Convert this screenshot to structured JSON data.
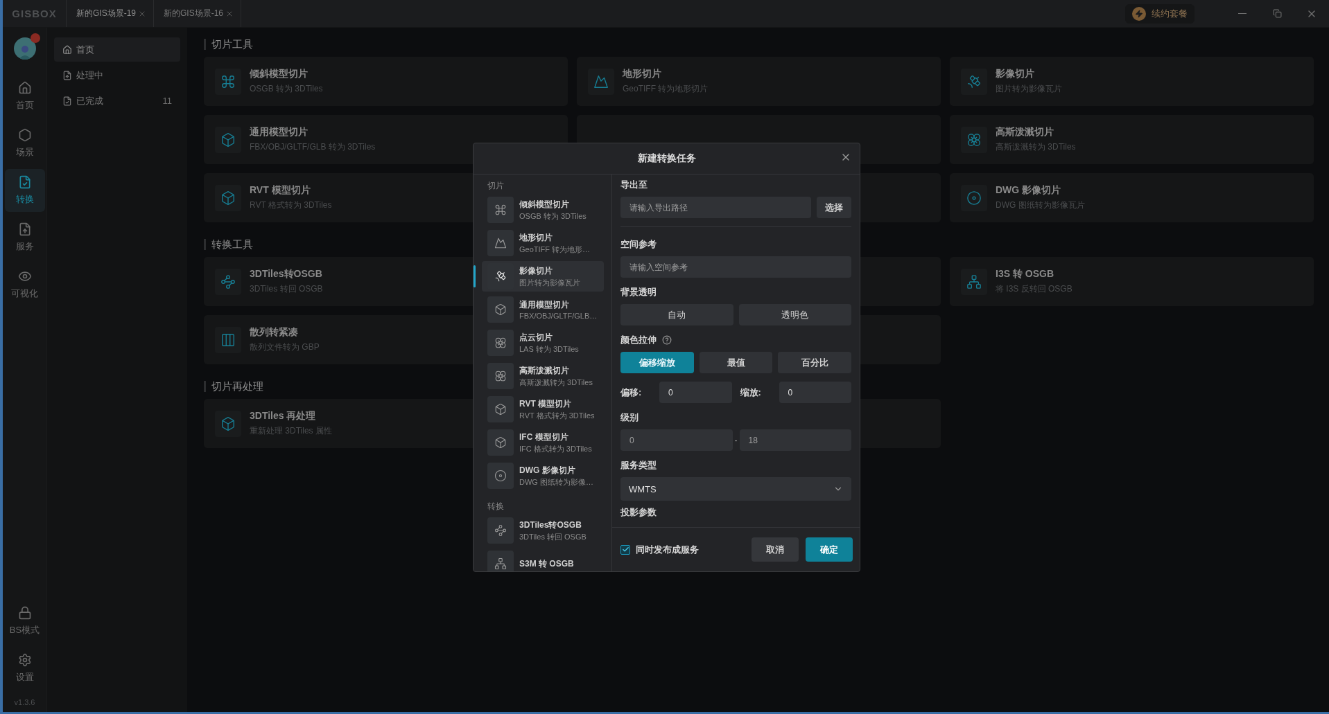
{
  "titlebar": {
    "logo": "GISBOX",
    "tabs": [
      {
        "label": "新的GIS场景-19",
        "selected": true
      },
      {
        "label": "新的GIS场景-16",
        "selected": false
      }
    ],
    "renew_button": "续约套餐"
  },
  "rail": {
    "items": [
      {
        "label": "首页",
        "selected": false
      },
      {
        "label": "场景",
        "selected": false
      },
      {
        "label": "转换",
        "selected": true
      },
      {
        "label": "服务",
        "selected": false
      },
      {
        "label": "可视化",
        "selected": false
      }
    ],
    "bottom_items": [
      {
        "label": "BS模式"
      },
      {
        "label": "设置"
      }
    ],
    "version": "v1.3.6"
  },
  "nav": {
    "items": [
      {
        "label": "首页",
        "selected": true
      },
      {
        "label": "处理中",
        "selected": false
      },
      {
        "label": "已完成",
        "selected": false,
        "count": "11"
      }
    ]
  },
  "sections": [
    {
      "title": "切片工具",
      "cards": [
        {
          "kind": "tool",
          "title": "倾斜模型切片",
          "subtitle": "OSGB 转为 3DTiles"
        },
        {
          "kind": "tool",
          "title": "地形切片",
          "subtitle": "GeoTIFF 转为地形切片"
        },
        {
          "kind": "tool",
          "title": "影像切片",
          "subtitle": "图片转为影像瓦片"
        },
        {
          "kind": "tool",
          "title": "通用模型切片",
          "subtitle": "FBX/OBJ/GLTF/GLB 转为 3DTiles"
        },
        {
          "kind": "covered"
        },
        {
          "kind": "tool",
          "title": "高斯泼溅切片",
          "subtitle": "高斯泼溅转为 3DTiles"
        },
        {
          "kind": "tool",
          "title": "RVT 模型切片",
          "subtitle": "RVT 格式转为 3DTiles"
        },
        {
          "kind": "covered"
        },
        {
          "kind": "tool",
          "title": "DWG 影像切片",
          "subtitle": "DWG 图纸转为影像瓦片"
        }
      ]
    },
    {
      "title": "转换工具",
      "cards": [
        {
          "kind": "tool",
          "title": "3DTiles转OSGB",
          "subtitle": "3DTiles 转回 OSGB"
        },
        {
          "kind": "covered"
        },
        {
          "kind": "tool",
          "title": "I3S 转 OSGB",
          "subtitle": "将 I3S 反转回 OSGB"
        },
        {
          "kind": "tool",
          "title": "散列转紧凑",
          "subtitle": "散列文件转为 GBP"
        },
        {
          "kind": "covered"
        }
      ]
    },
    {
      "title": "切片再处理",
      "cards": [
        {
          "kind": "tool",
          "title": "3DTiles 再处理",
          "subtitle": "重新处理 3DTiles 属性"
        },
        {
          "kind": "covered"
        }
      ]
    }
  ],
  "dialog": {
    "title": "新建转换任务",
    "groups": [
      {
        "title": "切片",
        "items": [
          {
            "title": "倾斜模型切片",
            "subtitle": "OSGB 转为 3DTiles",
            "selected": false
          },
          {
            "title": "地形切片",
            "subtitle": "GeoTIFF 转为地形…",
            "selected": false
          },
          {
            "title": "影像切片",
            "subtitle": "图片转为影像瓦片",
            "selected": true
          },
          {
            "title": "通用模型切片",
            "subtitle": "FBX/OBJ/GLTF/GLB…",
            "selected": false
          },
          {
            "title": "点云切片",
            "subtitle": "LAS 转为 3DTiles",
            "selected": false
          },
          {
            "title": "高斯泼溅切片",
            "subtitle": "高斯泼溅转为 3DTiles",
            "selected": false
          },
          {
            "title": "RVT 模型切片",
            "subtitle": "RVT 格式转为 3DTiles",
            "selected": false
          },
          {
            "title": "IFC 模型切片",
            "subtitle": "IFC 格式转为 3DTiles",
            "selected": false
          },
          {
            "title": "DWG 影像切片",
            "subtitle": "DWG 图纸转为影像…",
            "selected": false
          }
        ]
      },
      {
        "title": "转换",
        "items": [
          {
            "title": "3DTiles转OSGB",
            "subtitle": "3DTiles 转回 OSGB",
            "selected": false
          },
          {
            "title": "S3M 转 OSGB",
            "selected": false
          }
        ]
      }
    ],
    "export": {
      "label": "导出至",
      "placeholder": "请输入导出路径",
      "button": "选择"
    },
    "spatial_ref": {
      "label": "空间参考",
      "placeholder": "请输入空间参考"
    },
    "background": {
      "label": "背景透明",
      "options": [
        {
          "label": "自动",
          "selected": false
        },
        {
          "label": "透明色",
          "selected": false
        }
      ]
    },
    "stretch": {
      "label": "颜色拉伸",
      "options": [
        {
          "label": "偏移缩放",
          "selected": true
        },
        {
          "label": "最值",
          "selected": false
        },
        {
          "label": "百分比",
          "selected": false
        }
      ]
    },
    "offset": {
      "label": "偏移:",
      "value": "0"
    },
    "scale": {
      "label": "缩放:",
      "value": "0"
    },
    "level": {
      "label": "级别",
      "from_placeholder": "0",
      "separator": "-",
      "to_placeholder": "18"
    },
    "service_type": {
      "label": "服务类型",
      "value": "WMTS"
    },
    "projection": {
      "label": "投影参数"
    },
    "publish": {
      "label": "同时发布成服务",
      "checked": true
    },
    "buttons": {
      "cancel": "取消",
      "ok": "确定"
    }
  }
}
